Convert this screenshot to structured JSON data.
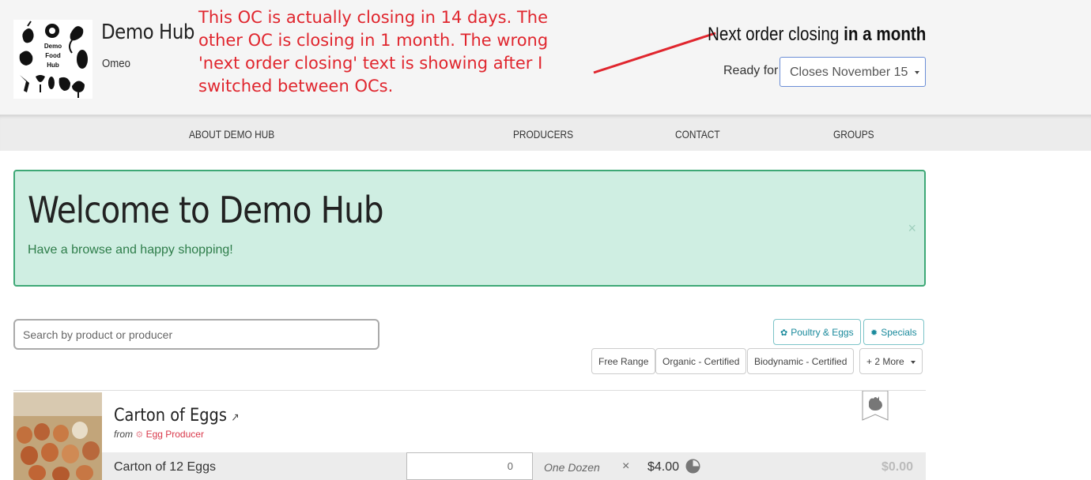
{
  "header": {
    "logo_text": [
      "Demo",
      "Food",
      "Hub"
    ],
    "hub_name": "Demo Hub",
    "hub_location": "Omeo",
    "annotation": "This OC is actually closing in 14 days. The other OC is closing in 1 month. The wrong 'next order closing' text is showing after I switched between OCs.",
    "next_order_prefix": "Next order closing",
    "next_order_value": "in a month",
    "ready_for_label": "Ready for",
    "order_cycle_selected": "Closes November 15",
    "annotation_color": "#e0262e"
  },
  "nav": {
    "items": [
      "ABOUT DEMO HUB",
      "PRODUCERS",
      "CONTACT",
      "GROUPS"
    ]
  },
  "welcome": {
    "title": "Welcome to Demo Hub",
    "message": "Have a browse and happy shopping!",
    "close_label": "×"
  },
  "search": {
    "placeholder": "Search by product or producer",
    "value": ""
  },
  "filters": {
    "taxons": [
      "Poultry & Eggs",
      "Specials"
    ],
    "properties": [
      "Free Range",
      "Organic - Certified",
      "Biodynamic - Certified",
      "+ 2 More"
    ]
  },
  "products": [
    {
      "name": "Carton of Eggs",
      "from_label": "from",
      "producer": "Egg Producer",
      "icon": "chicken-icon",
      "variants": [
        {
          "name": "Carton of 12 Eggs",
          "quantity": "0",
          "unit": "One Dozen",
          "times": "×",
          "price": "$4.00",
          "total": "$0.00"
        }
      ]
    }
  ],
  "colors": {
    "welcome_bg": "#cfeee2",
    "welcome_border": "#3ea876",
    "taxon_accent": "#1a8a9c",
    "producer_link": "#d9384a"
  }
}
